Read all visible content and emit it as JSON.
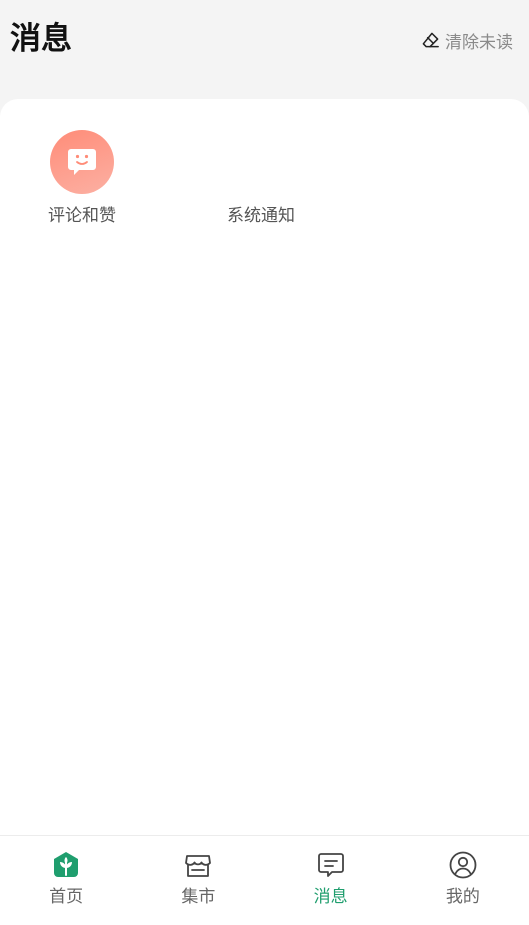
{
  "header": {
    "title": "消息",
    "clear_unread_label": "清除未读",
    "clear_icon": "eraser-icon"
  },
  "categories": [
    {
      "label": "评论和赞",
      "icon": "chat-smile-icon"
    },
    {
      "label": "系统通知",
      "icon": "system-notification-icon"
    }
  ],
  "tabbar": {
    "active": "消息",
    "accent_color": "#1f9e6e",
    "tabs": [
      {
        "label": "首页",
        "icon": "home-plant-icon"
      },
      {
        "label": "集市",
        "icon": "store-icon"
      },
      {
        "label": "消息",
        "icon": "message-icon"
      },
      {
        "label": "我的",
        "icon": "user-icon"
      }
    ]
  },
  "colors": {
    "comment_icon_gradient": [
      "#ff8c78",
      "#fcb0a3"
    ]
  }
}
